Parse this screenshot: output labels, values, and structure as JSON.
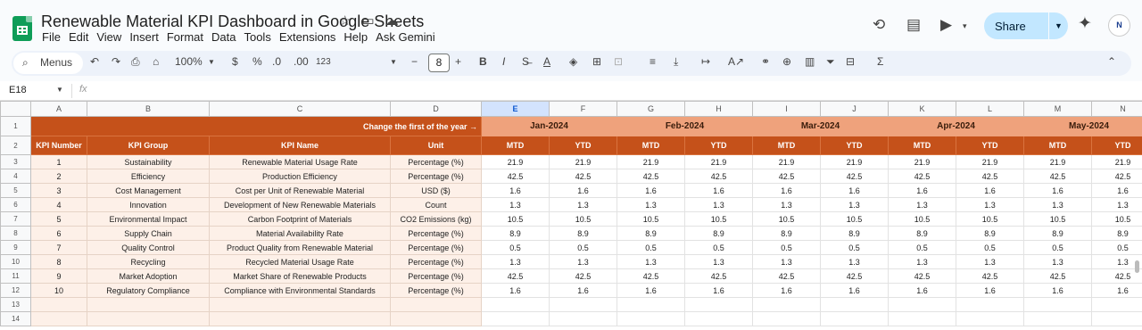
{
  "app": {
    "doc_title": "Renewable Material KPI Dashboard in Google Sheets",
    "menu": [
      "File",
      "Edit",
      "View",
      "Insert",
      "Format",
      "Data",
      "Tools",
      "Extensions",
      "Help",
      "Ask Gemini"
    ],
    "share_label": "Share",
    "avatar_text": "N",
    "icons": {
      "title": [
        "star-icon",
        "move-folder-icon",
        "cloud-status-icon"
      ],
      "right": [
        "history-icon",
        "comment-icon",
        "meet-icon",
        "gemini-icon"
      ]
    }
  },
  "toolbar": {
    "menus_label": "Menus",
    "zoom": "100%",
    "currency": "$",
    "percent": "%",
    "dec_decrease": ".0",
    "dec_increase": ".00",
    "number_format": "123",
    "font_size": "8",
    "bold": "B",
    "italic": "I",
    "text_color": "A",
    "sum": "Σ"
  },
  "formula_bar": {
    "cell_ref": "E18",
    "fx_label": "fx"
  },
  "sheet": {
    "columns": [
      "A",
      "B",
      "C",
      "D",
      "E",
      "F",
      "G",
      "H",
      "I",
      "J",
      "K",
      "L",
      "M",
      "N"
    ],
    "selected_column": "E",
    "row_numbers": [
      "1",
      "2",
      "3",
      "4",
      "5",
      "6",
      "7",
      "8",
      "9",
      "10",
      "11",
      "12",
      "13",
      "14"
    ],
    "change_year_label": "Change the first of the year →",
    "months": [
      "Jan-2024",
      "Feb-2024",
      "Mar-2024",
      "Apr-2024",
      "May-2024"
    ],
    "headers": [
      "KPI Number",
      "KPI Group",
      "KPI Name",
      "Unit"
    ],
    "mtd_label": "MTD",
    "ytd_label": "YTD",
    "rows": [
      {
        "num": "1",
        "group": "Sustainability",
        "name": "Renewable Material Usage Rate",
        "unit": "Percentage (%)",
        "val": "21.9"
      },
      {
        "num": "2",
        "group": "Efficiency",
        "name": "Production Efficiency",
        "unit": "Percentage (%)",
        "val": "42.5"
      },
      {
        "num": "3",
        "group": "Cost Management",
        "name": "Cost per Unit of Renewable Material",
        "unit": "USD ($)",
        "val": "1.6"
      },
      {
        "num": "4",
        "group": "Innovation",
        "name": "Development of New Renewable Materials",
        "unit": "Count",
        "val": "1.3"
      },
      {
        "num": "5",
        "group": "Environmental Impact",
        "name": "Carbon Footprint of Materials",
        "unit": "CO2 Emissions (kg)",
        "val": "10.5"
      },
      {
        "num": "6",
        "group": "Supply Chain",
        "name": "Material Availability Rate",
        "unit": "Percentage (%)",
        "val": "8.9"
      },
      {
        "num": "7",
        "group": "Quality Control",
        "name": "Product Quality from Renewable Material",
        "unit": "Percentage (%)",
        "val": "0.5"
      },
      {
        "num": "8",
        "group": "Recycling",
        "name": "Recycled Material Usage Rate",
        "unit": "Percentage (%)",
        "val": "1.3"
      },
      {
        "num": "9",
        "group": "Market Adoption",
        "name": "Market Share of Renewable Products",
        "unit": "Percentage (%)",
        "val": "42.5"
      },
      {
        "num": "10",
        "group": "Regulatory Compliance",
        "name": "Compliance with Environmental Standards",
        "unit": "Percentage (%)",
        "val": "1.6"
      }
    ]
  }
}
